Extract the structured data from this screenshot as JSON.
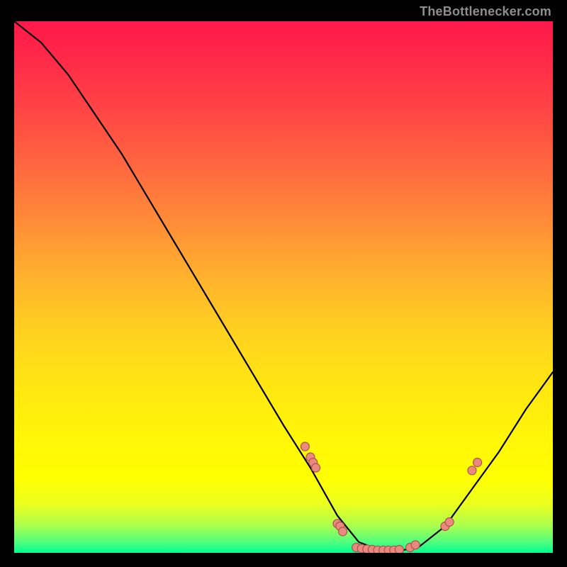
{
  "attribution": "TheBottlenecker.com",
  "chart_data": {
    "type": "line",
    "title": "",
    "xlabel": "",
    "ylabel": "",
    "xlim": [
      0,
      100
    ],
    "ylim": [
      0,
      100
    ],
    "background_gradient": [
      "#ff184a",
      "#ffff00",
      "#00ff90"
    ],
    "curve": {
      "note": "Percentage x mapped left→right, percentage y mapped bottom→top of plot box. Approximate trace of the visible black curve.",
      "points": [
        {
          "x": 0,
          "y": 100
        },
        {
          "x": 5,
          "y": 96
        },
        {
          "x": 10,
          "y": 90
        },
        {
          "x": 20,
          "y": 75
        },
        {
          "x": 30,
          "y": 58
        },
        {
          "x": 40,
          "y": 41
        },
        {
          "x": 50,
          "y": 24
        },
        {
          "x": 55,
          "y": 16
        },
        {
          "x": 60,
          "y": 7
        },
        {
          "x": 64,
          "y": 2
        },
        {
          "x": 68,
          "y": 0.5
        },
        {
          "x": 72,
          "y": 0.5
        },
        {
          "x": 75,
          "y": 1
        },
        {
          "x": 80,
          "y": 5
        },
        {
          "x": 85,
          "y": 12
        },
        {
          "x": 90,
          "y": 19
        },
        {
          "x": 95,
          "y": 27
        },
        {
          "x": 100,
          "y": 34
        }
      ]
    },
    "markers": {
      "note": "Salmon dots along the curve, grouped on the lower section.",
      "points": [
        {
          "x": 54,
          "y": 20
        },
        {
          "x": 55,
          "y": 18
        },
        {
          "x": 55.5,
          "y": 17
        },
        {
          "x": 56,
          "y": 16
        },
        {
          "x": 60,
          "y": 5.5
        },
        {
          "x": 60.5,
          "y": 5
        },
        {
          "x": 61,
          "y": 4
        },
        {
          "x": 63.5,
          "y": 1
        },
        {
          "x": 64.5,
          "y": 0.8
        },
        {
          "x": 65.5,
          "y": 0.7
        },
        {
          "x": 66.5,
          "y": 0.6
        },
        {
          "x": 67.5,
          "y": 0.5
        },
        {
          "x": 68.5,
          "y": 0.5
        },
        {
          "x": 69.5,
          "y": 0.5
        },
        {
          "x": 70.5,
          "y": 0.5
        },
        {
          "x": 71.5,
          "y": 0.6
        },
        {
          "x": 73.5,
          "y": 1
        },
        {
          "x": 74.5,
          "y": 1.5
        },
        {
          "x": 80,
          "y": 5
        },
        {
          "x": 80.8,
          "y": 5.8
        },
        {
          "x": 85,
          "y": 15.5
        },
        {
          "x": 86,
          "y": 17
        }
      ]
    }
  }
}
